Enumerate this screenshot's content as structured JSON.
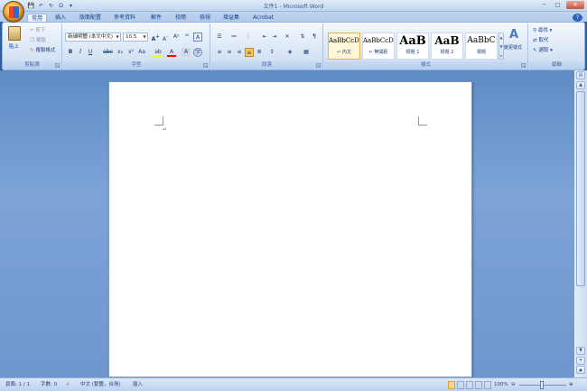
{
  "window": {
    "title": "文件1 - Microsoft Word",
    "minimize": "─",
    "maximize": "□",
    "close": "✕"
  },
  "quick_access": [
    "💾",
    "↶",
    "↻",
    "Ω",
    "▾"
  ],
  "tabs": [
    "常用",
    "插入",
    "版面配置",
    "參考資料",
    "郵件",
    "校閱",
    "檢視",
    "增益集",
    "Acrobat"
  ],
  "active_tab": "常用",
  "help_label": "?",
  "clipboard": {
    "paste_label": "貼上",
    "cut_label": "剪下",
    "copy_label": "複製",
    "format_painter_label": "複製格式",
    "group_label": "剪貼簿"
  },
  "font": {
    "font_name": "新細明體 (本文中文)",
    "font_size": "10.5",
    "group_label": "字型"
  },
  "paragraph": {
    "group_label": "段落"
  },
  "styles": {
    "items": [
      {
        "sample": "AaBbCcDc",
        "name": "↵ 內文"
      },
      {
        "sample": "AaBbCcDc",
        "name": "↵ 無間距"
      },
      {
        "sample": "AaB",
        "name": "標題 1"
      },
      {
        "sample": "AaB",
        "name": "標題 2"
      },
      {
        "sample": "AaBbC",
        "name": "標題"
      }
    ],
    "change_styles_label": "變更樣式",
    "group_label": "樣式"
  },
  "editing": {
    "find_label": "尋找",
    "replace_label": "取代",
    "select_label": "選取",
    "group_label": "編輯"
  },
  "status": {
    "page": "頁面: 1 / 1",
    "words": "字數: 0",
    "language": "中文 (繁體，台灣)",
    "mode": "插入",
    "zoom": "100%"
  },
  "colors": {
    "highlight": "#ffff00",
    "font_color": "#ff0000"
  }
}
